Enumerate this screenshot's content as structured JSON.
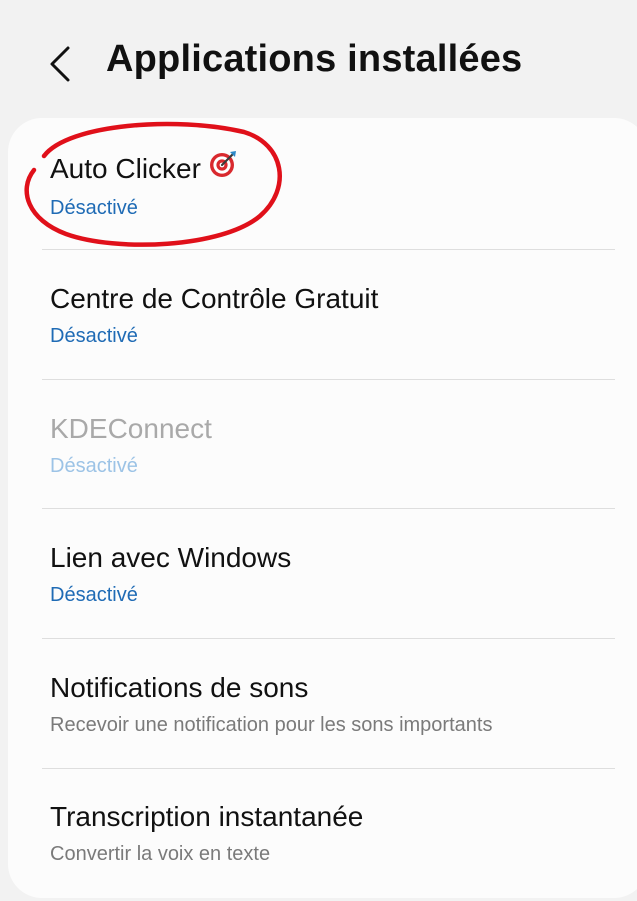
{
  "header": {
    "title": "Applications installées"
  },
  "apps": [
    {
      "name": "Auto Clicker",
      "status": "Désactivé",
      "emoji": "🎯"
    },
    {
      "name": "Centre de Contrôle Gratuit",
      "status": "Désactivé"
    },
    {
      "name": "KDEConnect",
      "status": "Désactivé"
    },
    {
      "name": "Lien avec Windows",
      "status": "Désactivé"
    },
    {
      "name": "Notifications de sons",
      "status": "Recevoir une notification pour les sons importants"
    },
    {
      "name": "Transcription instantanée",
      "status": "Convertir la voix en texte"
    }
  ],
  "colors": {
    "background": "#f2f2f2",
    "card": "#fcfcfc",
    "status_blue": "#1f6bb5",
    "annotation_red": "#e0101a"
  },
  "icons": {
    "back": "chevron-left-icon",
    "auto_clicker": "target-icon"
  }
}
